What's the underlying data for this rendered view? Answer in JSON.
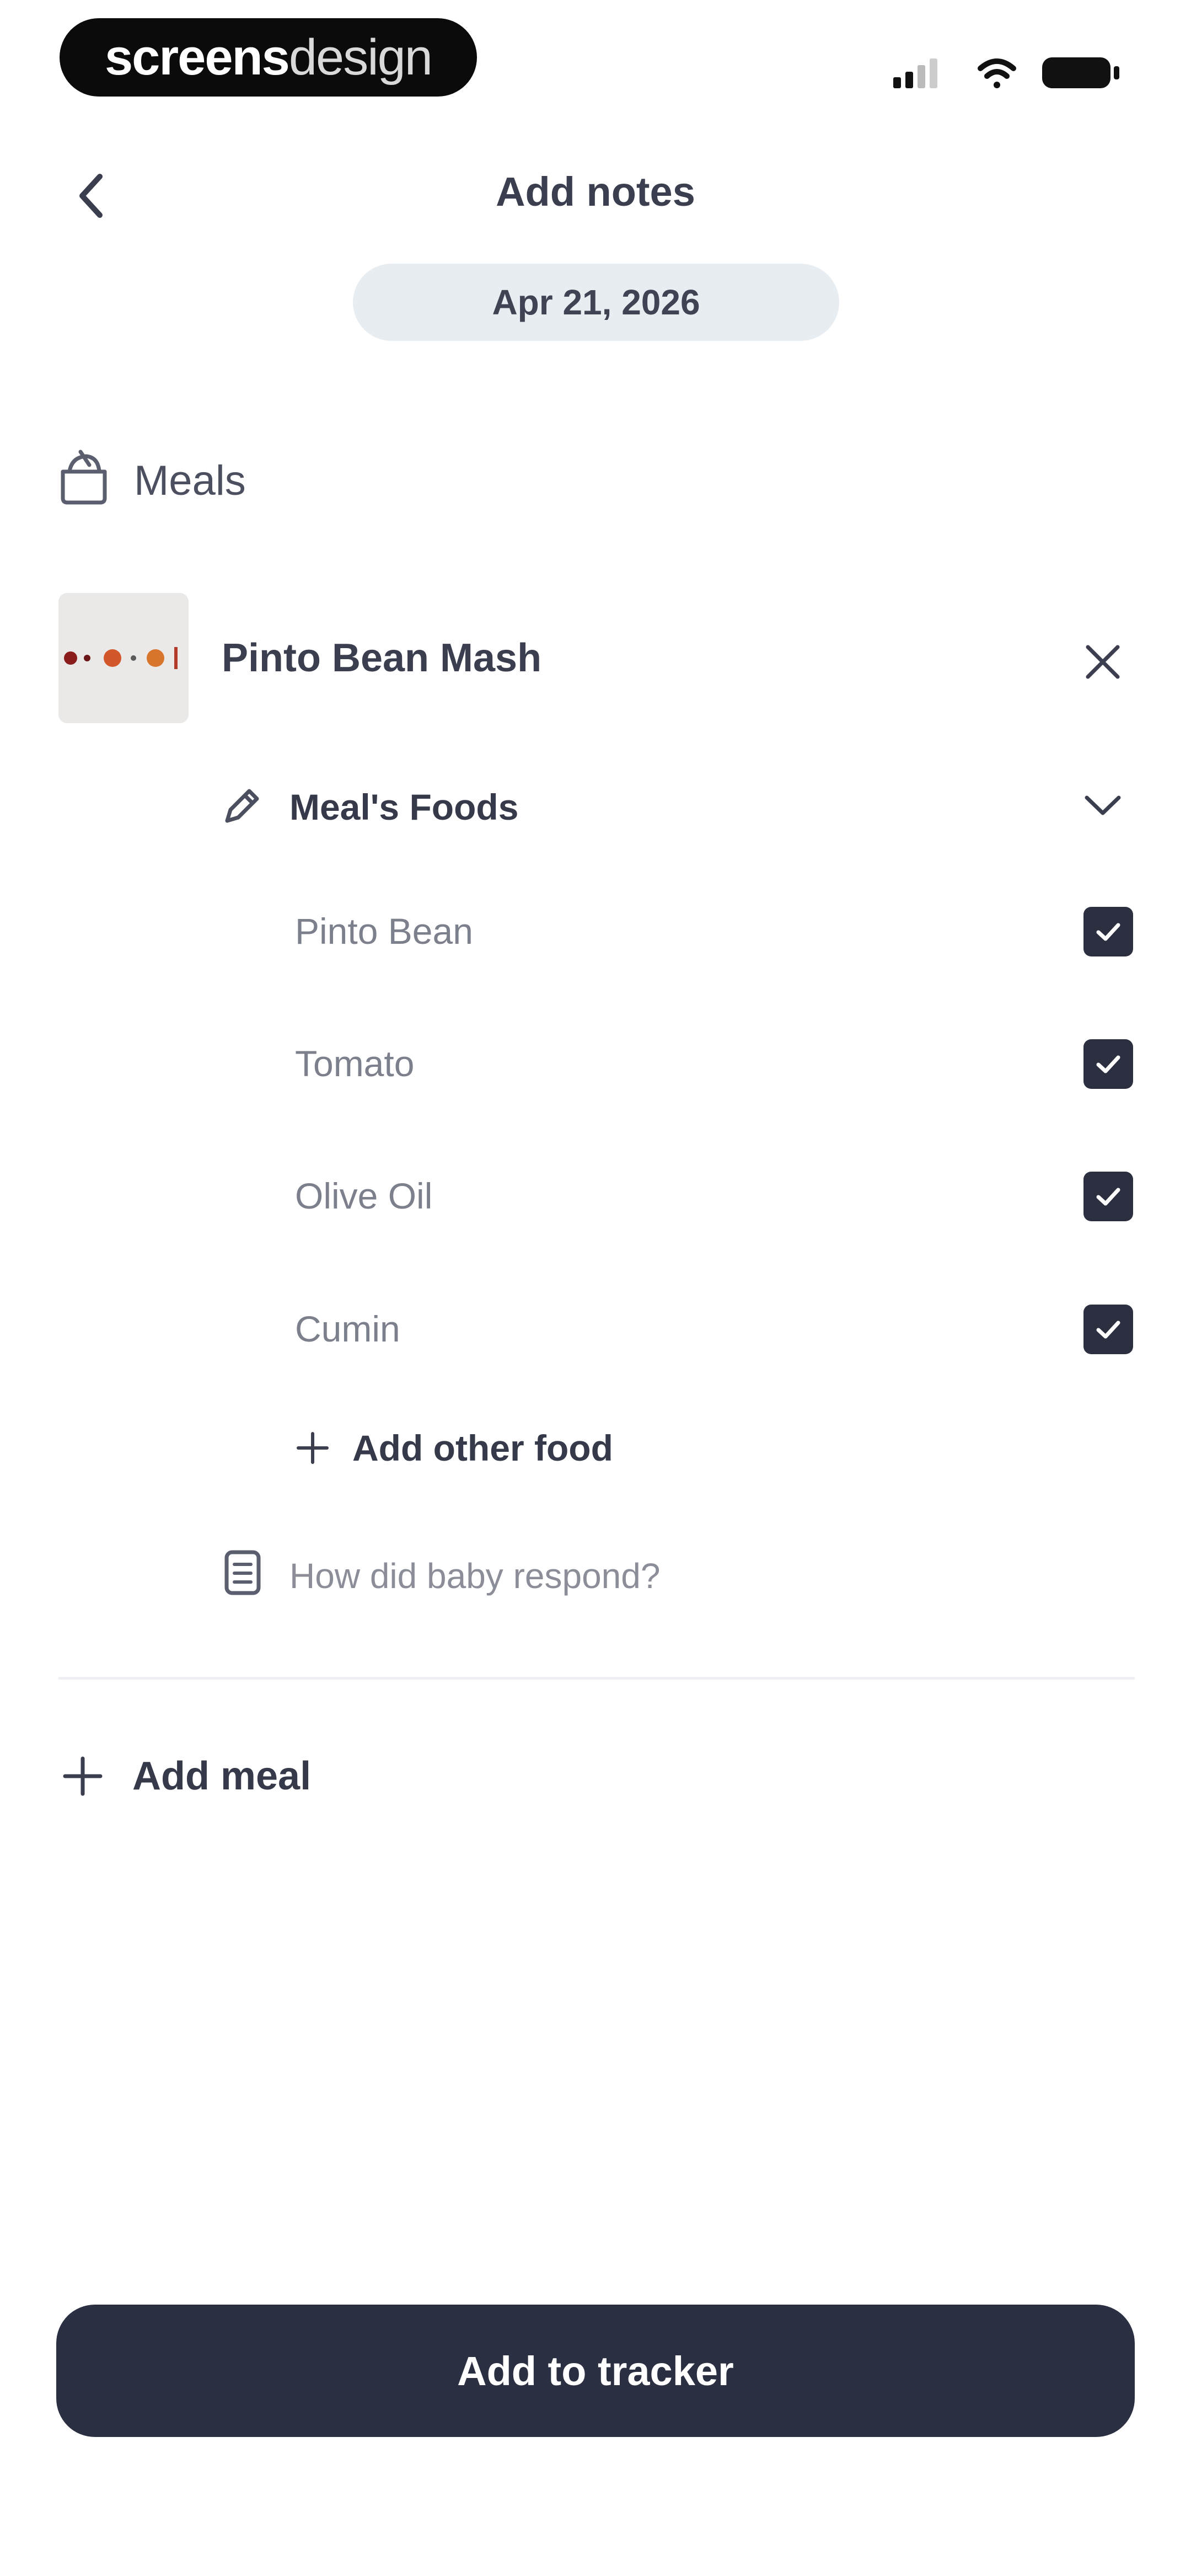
{
  "status_bar": {
    "logo_part1": "screens",
    "logo_part2": "design"
  },
  "header": {
    "title": "Add notes",
    "date": "Apr 21, 2026"
  },
  "meals_section": {
    "label": "Meals",
    "meal": {
      "name": "Pinto Bean Mash",
      "foods_header": "Meal's Foods",
      "foods": [
        {
          "label": "Pinto Bean",
          "checked": true
        },
        {
          "label": "Tomato",
          "checked": true
        },
        {
          "label": "Olive Oil",
          "checked": true
        },
        {
          "label": "Cumin",
          "checked": true
        }
      ],
      "add_food_label": "Add other food",
      "respond_placeholder": "How did baby respond?"
    },
    "add_meal_label": "Add meal"
  },
  "footer": {
    "cta_label": "Add to tracker"
  },
  "colors": {
    "primary_dark": "#2b2f42",
    "date_pill_bg": "#e8edf2",
    "background": "#ffffff"
  }
}
